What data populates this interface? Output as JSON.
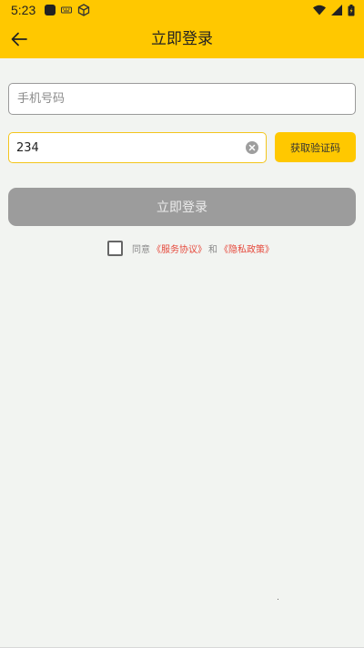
{
  "status_bar": {
    "time": "5:23",
    "left_icons": [
      "app-square-icon",
      "keyboard-icon",
      "cube-icon"
    ],
    "right_icons": [
      "wifi-icon",
      "signal-icon",
      "battery-icon"
    ]
  },
  "app_bar": {
    "title": "立即登录",
    "back_icon": "arrow-left-icon",
    "background": "#ffc800"
  },
  "form": {
    "phone_placeholder": "手机号码",
    "phone_value": "",
    "code_value": "234",
    "code_placeholder": "",
    "get_code_label": "获取验证码",
    "login_label": "立即登录"
  },
  "agreement": {
    "checked": false,
    "prefix": "同意",
    "service_link": "《服务协议》",
    "and": "和",
    "privacy_link": "《隐私政策》"
  },
  "colors": {
    "accent": "#ffc800",
    "link": "#e6493c",
    "disabled_button": "#9c9c9c"
  }
}
